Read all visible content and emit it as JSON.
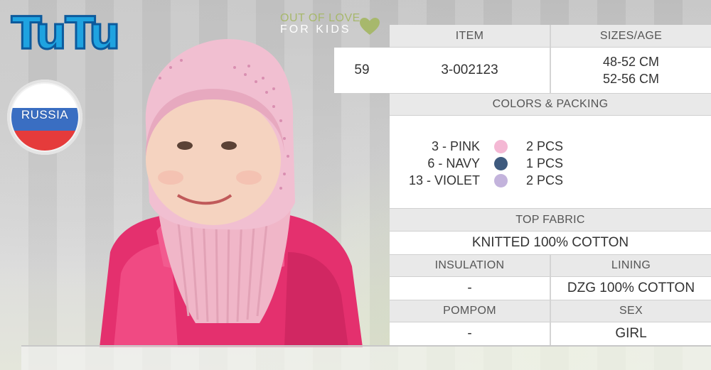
{
  "brand": {
    "logo_text": "TuTu"
  },
  "slogan": {
    "line1": "OUT OF LOVE",
    "line2": "FOR KIDS"
  },
  "badge": {
    "country": "RUSSIA"
  },
  "colors_theme": {
    "accent_green": "#a7b86c",
    "logo_blue": "#1fa3e0",
    "header_gray": "#e9e9e9"
  },
  "spec": {
    "item_header": "ITEM",
    "sizes_header": "SIZES/AGE",
    "model_no": "59",
    "item_code": "3-002123",
    "sizes": [
      "48-52 CM",
      "52-56 CM"
    ],
    "colors_header": "COLORS & PACKING",
    "colors": [
      {
        "label": "3 - PINK",
        "packing": "2 PCS",
        "swatch": "#f4b8d4"
      },
      {
        "label": "6 - NAVY",
        "packing": "1 PCS",
        "swatch": "#3e5a7e"
      },
      {
        "label": "13 - VIOLET",
        "packing": "2 PCS",
        "swatch": "#c3b3dc"
      }
    ],
    "top_fabric_header": "TOP FABRIC",
    "top_fabric": "KNITTED 100% COTTON",
    "insulation_header": "INSULATION",
    "insulation": "-",
    "lining_header": "LINING",
    "lining": "DZG 100% COTTON",
    "pompom_header": "POMPOM",
    "pompom": "-",
    "sex_header": "SEX",
    "sex": "GIRL"
  }
}
